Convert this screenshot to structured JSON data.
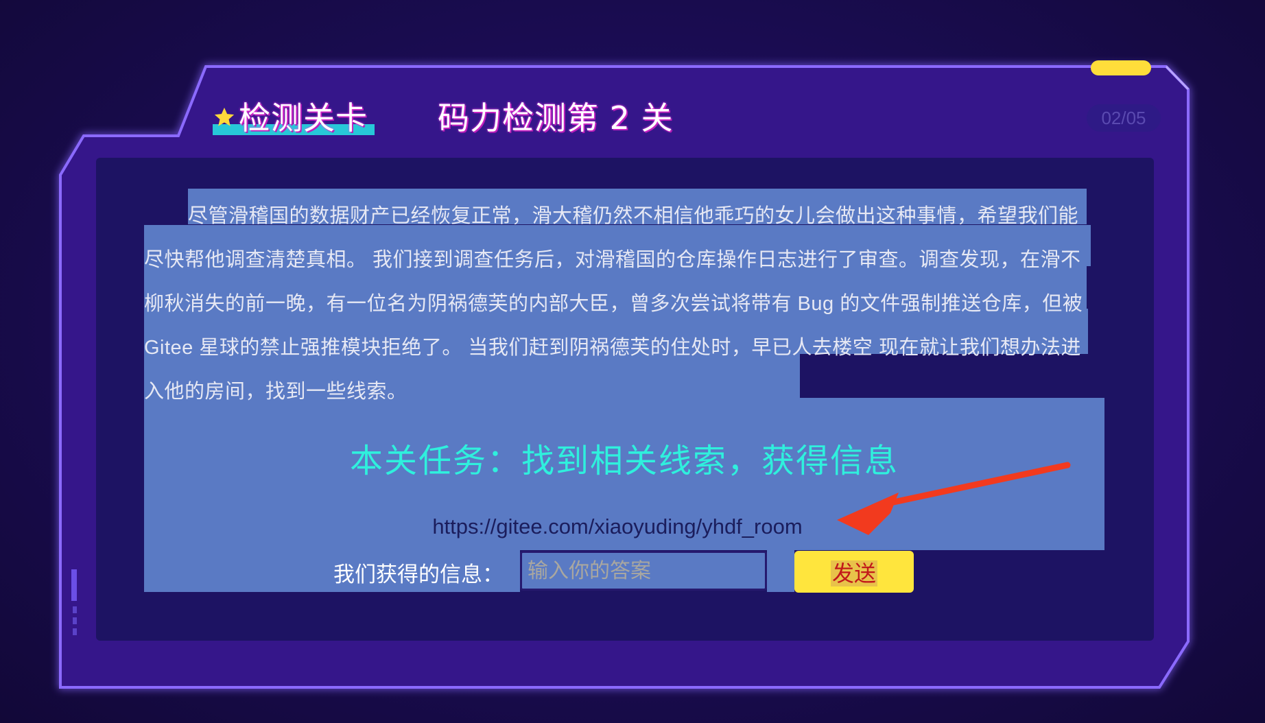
{
  "header": {
    "tab_label": "检测关卡",
    "level_title": "码力检测第 2 关",
    "page_counter": "02/05"
  },
  "story": {
    "text": "尽管滑稽国的数据财产已经恢复正常，滑大稽仍然不相信他乖巧的女儿会做出这种事情，希望我们能尽快帮他调查清楚真相。 我们接到调查任务后，对滑稽国的仓库操作日志进行了审查。调查发现，在滑不柳秋消失的前一晚，有一位名为阴祸德芙的内部大臣，曾多次尝试将带有 Bug 的文件强制推送仓库，但被 Gitee 星球的禁止强推模块拒绝了。 当我们赶到阴祸德芙的住处时，早已人去楼空 现在就让我们想办法进入他的房间，找到一些线索。"
  },
  "task": {
    "text": "本关任务：找到相关线索，获得信息"
  },
  "link": {
    "url": "https://gitee.com/xiaoyuding/yhdf_room"
  },
  "answer": {
    "label": "我们获得的信息：",
    "placeholder": "输入你的答案",
    "value": "",
    "send_label": "发送"
  },
  "colors": {
    "frame_border": "#7b5cff",
    "frame_fill": "#34198a",
    "inner_panel": "#1d1363",
    "selection": "#5a7ac4",
    "task_text": "#2ff0dd",
    "send_button": "#ffe53d",
    "arrow": "#f23a1e"
  },
  "icons": {
    "star": "star-icon",
    "arrow": "red-arrow-annotation"
  }
}
